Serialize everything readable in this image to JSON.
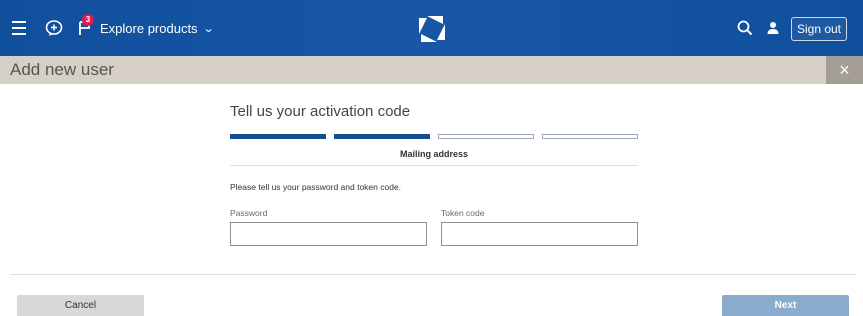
{
  "nav": {
    "notification_count": "3",
    "explore_label": "Explore products",
    "signout_label": "Sign out"
  },
  "modal": {
    "title": "Add new user",
    "close_glyph": "×"
  },
  "form": {
    "heading": "Tell us your activation code",
    "steps": [
      {
        "state": "complete"
      },
      {
        "state": "current"
      },
      {
        "state": "incomplete"
      },
      {
        "state": "incomplete"
      }
    ],
    "current_step_label": "Mailing address",
    "instructions": "Please tell us your password and token code.",
    "password_label": "Password",
    "password_value": "",
    "token_label": "Token code",
    "token_value": ""
  },
  "footer": {
    "cancel_label": "Cancel",
    "next_label": "Next"
  },
  "colors": {
    "nav_bg": "#0f4f9c",
    "header_bg": "#d6cfc6",
    "close_bg": "#a49e96",
    "step_active": "#144e8f",
    "next_bg": "#8aaccd",
    "badge": "#e01b4b"
  }
}
